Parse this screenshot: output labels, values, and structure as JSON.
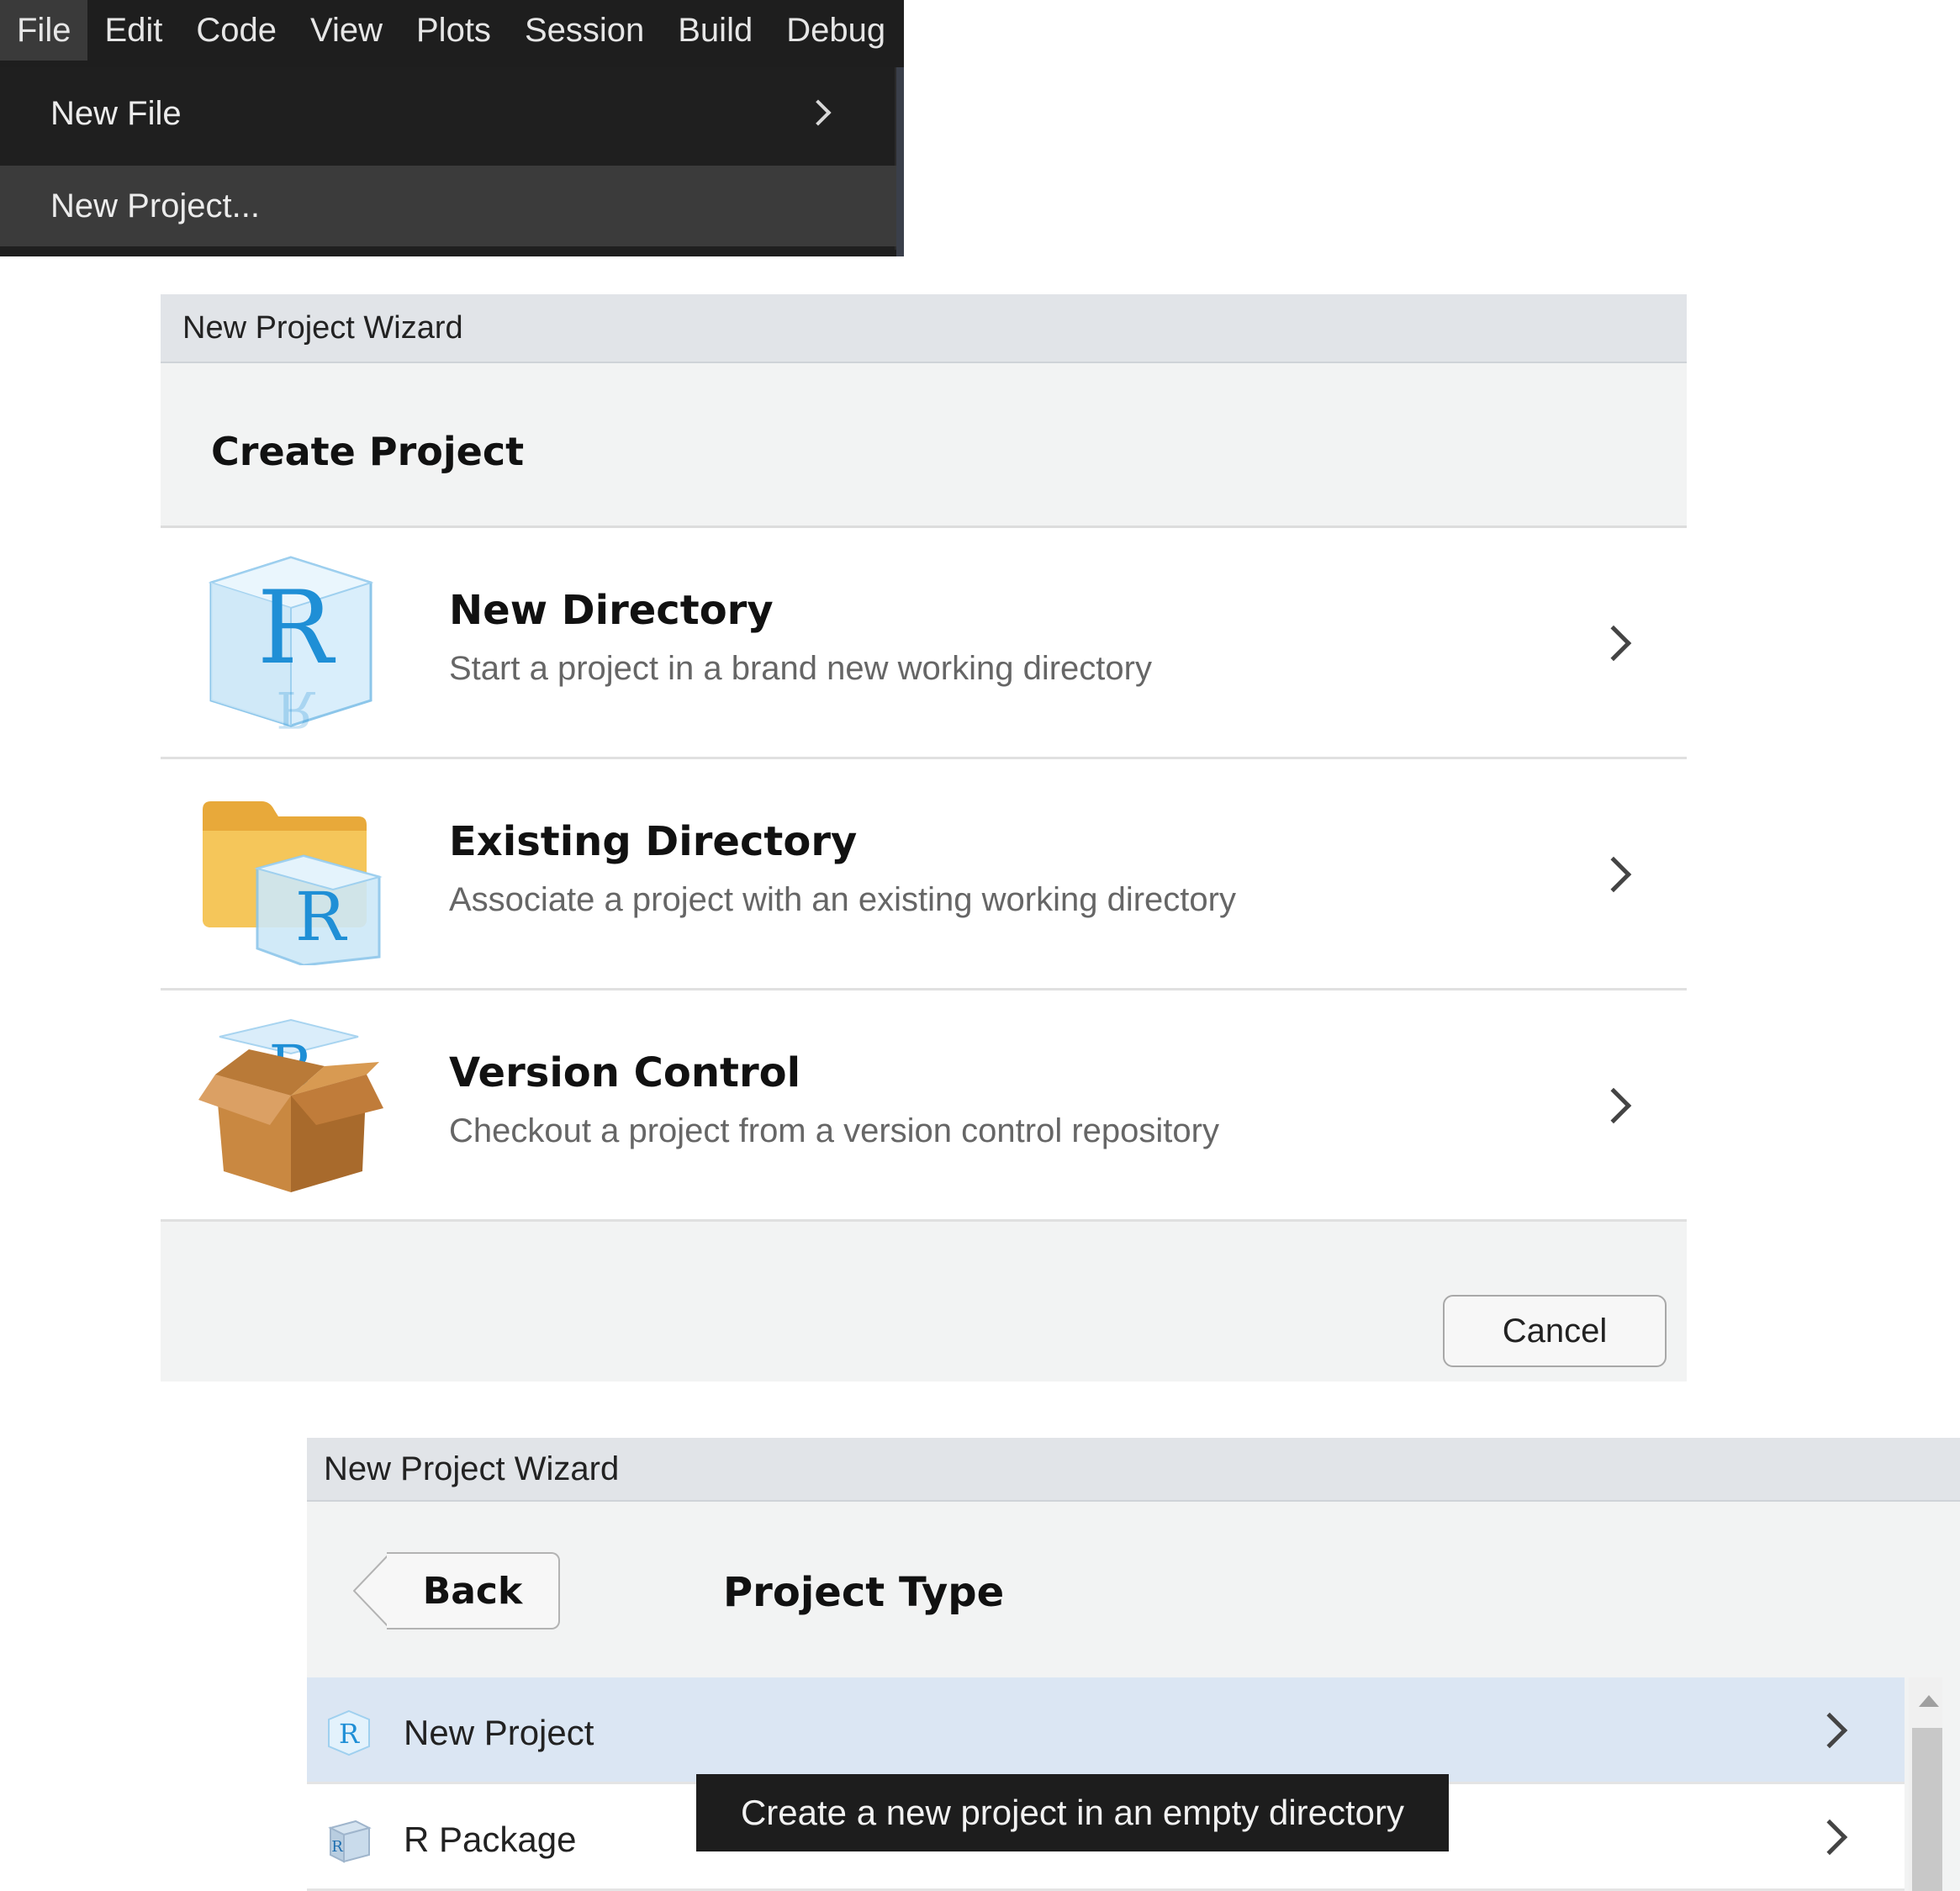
{
  "menubar": {
    "items": [
      {
        "label": "File",
        "active": true
      },
      {
        "label": "Edit"
      },
      {
        "label": "Code"
      },
      {
        "label": "View"
      },
      {
        "label": "Plots"
      },
      {
        "label": "Session"
      },
      {
        "label": "Build"
      },
      {
        "label": "Debug"
      }
    ]
  },
  "file_menu": {
    "items": [
      {
        "label": "New File",
        "has_submenu": true
      },
      {
        "label": "New Project...",
        "highlighted": true
      }
    ]
  },
  "create_project_dialog": {
    "window_title": "New Project Wizard",
    "heading": "Create Project",
    "options": [
      {
        "title": "New Directory",
        "description": "Start a project in a brand new working directory",
        "icon": "r-cube-icon"
      },
      {
        "title": "Existing Directory",
        "description": "Associate a project with an existing working directory",
        "icon": "folder-r-cube-icon"
      },
      {
        "title": "Version Control",
        "description": "Checkout a project from a version control repository",
        "icon": "cardboard-box-icon"
      }
    ],
    "cancel_label": "Cancel"
  },
  "project_type_dialog": {
    "window_title": "New Project Wizard",
    "back_label": "Back",
    "heading": "Project Type",
    "types": [
      {
        "label": "New Project",
        "selected": true,
        "icon": "r-project-icon"
      },
      {
        "label": "R Package",
        "icon": "r-package-icon"
      }
    ],
    "tooltip": "Create a new project in an empty directory"
  },
  "colors": {
    "menu_bg": "#1e1e1e",
    "dialog_bg": "#f2f3f3",
    "titlebar_bg": "#e1e4e8",
    "selected_row": "#dbe6f3",
    "r_blue": "#1f8fd6"
  }
}
